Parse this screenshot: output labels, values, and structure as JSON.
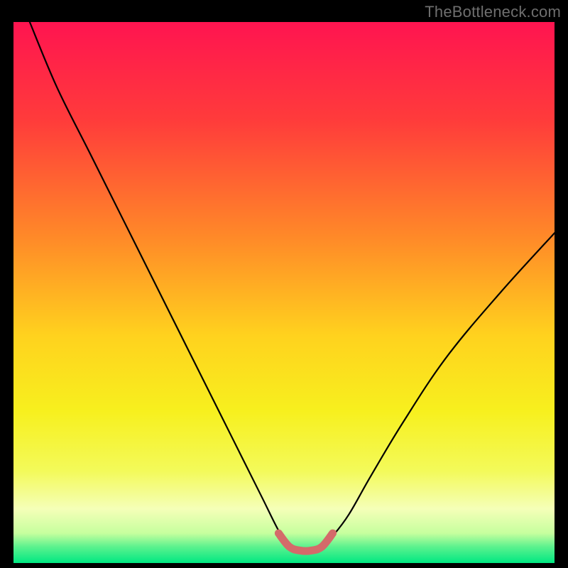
{
  "watermark_text": "TheBottleneck.com",
  "chart_data": {
    "type": "line",
    "title": "",
    "xlabel": "",
    "ylabel": "",
    "xlim": [
      0,
      100
    ],
    "ylim": [
      0,
      100
    ],
    "grid": false,
    "legend": false,
    "gradient_stops": [
      {
        "offset": 0.0,
        "color": "#ff1450"
      },
      {
        "offset": 0.18,
        "color": "#ff3b3b"
      },
      {
        "offset": 0.4,
        "color": "#ff8a28"
      },
      {
        "offset": 0.58,
        "color": "#ffd21e"
      },
      {
        "offset": 0.72,
        "color": "#f7f01e"
      },
      {
        "offset": 0.83,
        "color": "#f3fa5a"
      },
      {
        "offset": 0.9,
        "color": "#f5ffb8"
      },
      {
        "offset": 0.945,
        "color": "#c6ff9e"
      },
      {
        "offset": 0.97,
        "color": "#5cf28e"
      },
      {
        "offset": 1.0,
        "color": "#00e882"
      }
    ],
    "series": [
      {
        "name": "bottleneck-curve",
        "color": "#000000",
        "x": [
          3,
          8,
          14,
          20,
          26,
          32,
          38,
          42,
          46,
          49,
          51,
          53,
          55,
          57,
          59,
          62,
          66,
          72,
          80,
          90,
          100
        ],
        "y": [
          100,
          88,
          76,
          64,
          52,
          40,
          28,
          20,
          12,
          6,
          3,
          2,
          2,
          3,
          5,
          9,
          16,
          26,
          38,
          50,
          61
        ]
      },
      {
        "name": "flat-segment",
        "color": "#d46a6a",
        "thick": true,
        "x": [
          49,
          51,
          53,
          55,
          57,
          59
        ],
        "y": [
          5.5,
          3.0,
          2.3,
          2.3,
          3.0,
          5.5
        ]
      }
    ]
  }
}
